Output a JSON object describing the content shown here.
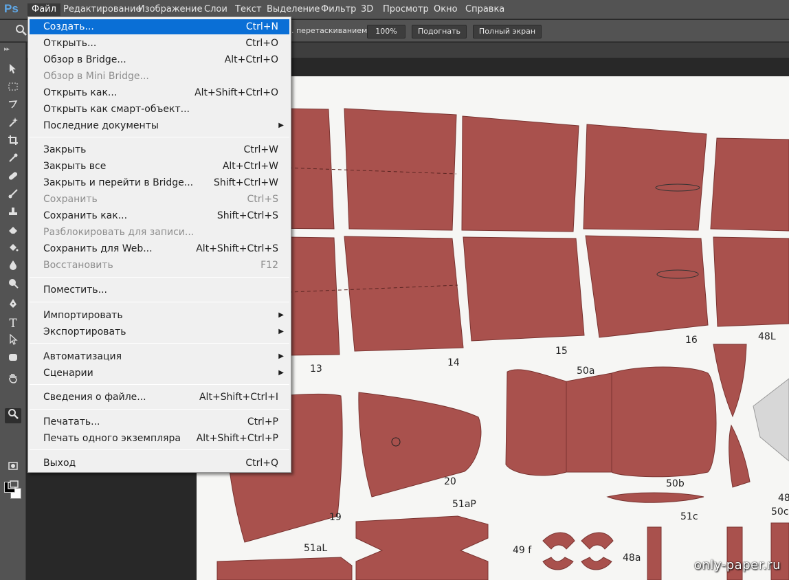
{
  "app": {
    "logo": "Ps"
  },
  "menubar": {
    "items": [
      "Файл",
      "Редактирование",
      "Изображение",
      "Слои",
      "Текст",
      "Выделение",
      "Фильтр",
      "3D",
      "Просмотр",
      "Окно",
      "Справка"
    ],
    "active": "Файл"
  },
  "options": {
    "tool_icon": "zoom-icon",
    "drag_label": ". перетаскиванием",
    "btn_100": "100%",
    "btn_fit": "Подогнать",
    "btn_fullscreen": "Полный экран"
  },
  "file_menu": {
    "items": [
      {
        "label": "Создать...",
        "shortcut": "Ctrl+N",
        "state": "highlighted"
      },
      {
        "label": "Открыть...",
        "shortcut": "Ctrl+O",
        "state": "enabled"
      },
      {
        "label": "Обзор в Bridge...",
        "shortcut": "Alt+Ctrl+O",
        "state": "enabled"
      },
      {
        "label": "Обзор в Mini Bridge...",
        "shortcut": "",
        "state": "disabled"
      },
      {
        "label": "Открыть как...",
        "shortcut": "Alt+Shift+Ctrl+O",
        "state": "enabled"
      },
      {
        "label": "Открыть как смарт-объект...",
        "shortcut": "",
        "state": "enabled"
      },
      {
        "label": "Последние документы",
        "shortcut": "",
        "state": "submenu"
      },
      {
        "label": "Закрыть",
        "shortcut": "Ctrl+W",
        "state": "enabled"
      },
      {
        "label": "Закрыть все",
        "shortcut": "Alt+Ctrl+W",
        "state": "enabled"
      },
      {
        "label": "Закрыть и перейти в Bridge...",
        "shortcut": "Shift+Ctrl+W",
        "state": "enabled"
      },
      {
        "label": "Сохранить",
        "shortcut": "Ctrl+S",
        "state": "disabled"
      },
      {
        "label": "Сохранить как...",
        "shortcut": "Shift+Ctrl+S",
        "state": "enabled"
      },
      {
        "label": "Разблокировать для записи...",
        "shortcut": "",
        "state": "disabled"
      },
      {
        "label": "Сохранить для Web...",
        "shortcut": "Alt+Shift+Ctrl+S",
        "state": "enabled"
      },
      {
        "label": "Восстановить",
        "shortcut": "F12",
        "state": "disabled"
      },
      {
        "label": "Поместить...",
        "shortcut": "",
        "state": "enabled"
      },
      {
        "label": "Импортировать",
        "shortcut": "",
        "state": "submenu"
      },
      {
        "label": "Экспортировать",
        "shortcut": "",
        "state": "submenu"
      },
      {
        "label": "Автоматизация",
        "shortcut": "",
        "state": "submenu"
      },
      {
        "label": "Сценарии",
        "shortcut": "",
        "state": "submenu"
      },
      {
        "label": "Сведения о файле...",
        "shortcut": "Alt+Shift+Ctrl+I",
        "state": "enabled"
      },
      {
        "label": "Печатать...",
        "shortcut": "Ctrl+P",
        "state": "enabled"
      },
      {
        "label": "Печать одного экземпляра",
        "shortcut": "Alt+Shift+Ctrl+P",
        "state": "enabled"
      },
      {
        "label": "Выход",
        "shortcut": "Ctrl+Q",
        "state": "enabled"
      }
    ]
  },
  "toolbar": {
    "tools": [
      "move-icon",
      "marquee-icon",
      "lasso-icon",
      "magic-wand-icon",
      "crop-icon",
      "eyedropper-icon",
      "healing-brush-icon",
      "brush-icon",
      "clone-stamp-icon",
      "eraser-icon",
      "paint-bucket-icon",
      "blur-icon",
      "dodge-icon",
      "pen-icon",
      "type-icon",
      "path-selection-icon",
      "shape-icon",
      "hand-icon",
      "zoom-icon"
    ],
    "active_tool": "zoom-icon"
  },
  "canvas_labels": {
    "p13": "13",
    "p14": "14",
    "p15": "15",
    "p16": "16",
    "p48L": "48L",
    "p50a": "50a",
    "p50b": "50b",
    "p19": "19",
    "p20": "20",
    "p51aP": "51aP",
    "p51aL": "51aL",
    "p51c": "51c",
    "p49f": "49 f",
    "p48a": "48a",
    "p48": "48",
    "p50c": "50c"
  },
  "colors": {
    "part_fill": "#a9514d",
    "part_stroke": "#7a3431",
    "menu_highlight": "#0a6fd6"
  },
  "watermark": "only-paper.ru"
}
